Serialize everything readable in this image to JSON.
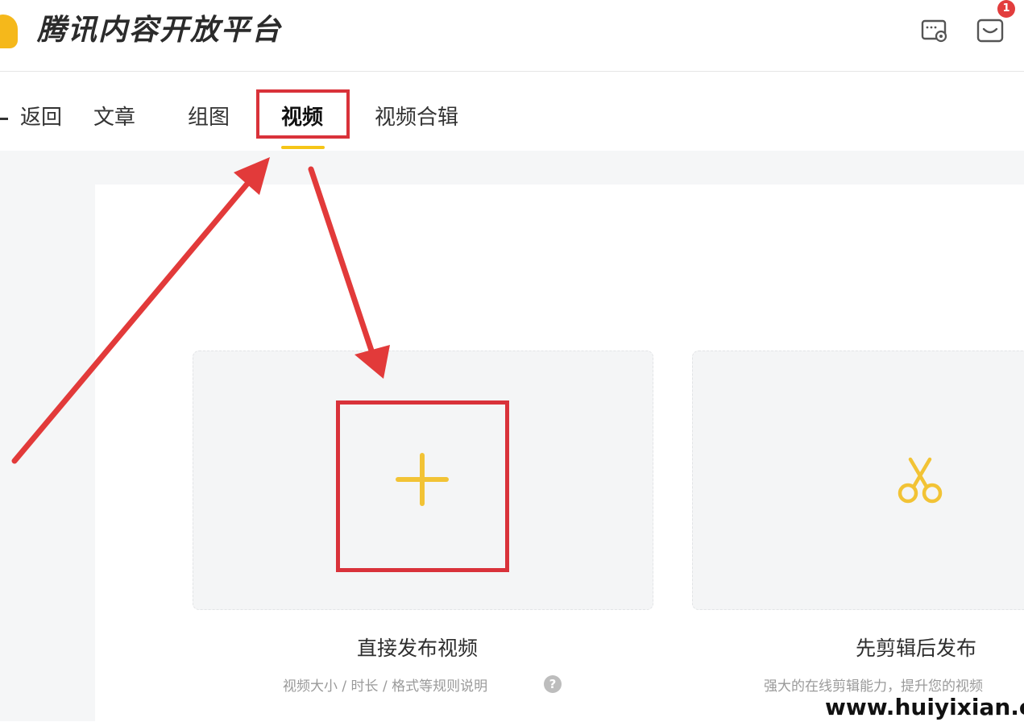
{
  "header": {
    "brand": "腾讯内容开放平台",
    "icons": [
      "settings-icon",
      "message-icon"
    ],
    "message_badge": "1"
  },
  "nav": {
    "back_label": "返回",
    "tabs": [
      {
        "label": "文章"
      },
      {
        "label": "组图"
      },
      {
        "label": "视频",
        "active": true
      },
      {
        "label": "视频合辑"
      }
    ]
  },
  "cards": {
    "direct": {
      "title": "直接发布视频",
      "subtitle": "视频大小 / 时长 / 格式等规则说明",
      "icon": "plus-icon"
    },
    "edit": {
      "title": "先剪辑后发布",
      "subtitle": "强大的在线剪辑能力，提升您的视频",
      "icon": "scissors-icon"
    }
  },
  "watermark": "www.huiyixian.com",
  "colors": {
    "accent": "#f5c518",
    "icon_yellow": "#f2c335",
    "annotation_red": "#d9323a",
    "badge_red": "#e23d3d"
  }
}
